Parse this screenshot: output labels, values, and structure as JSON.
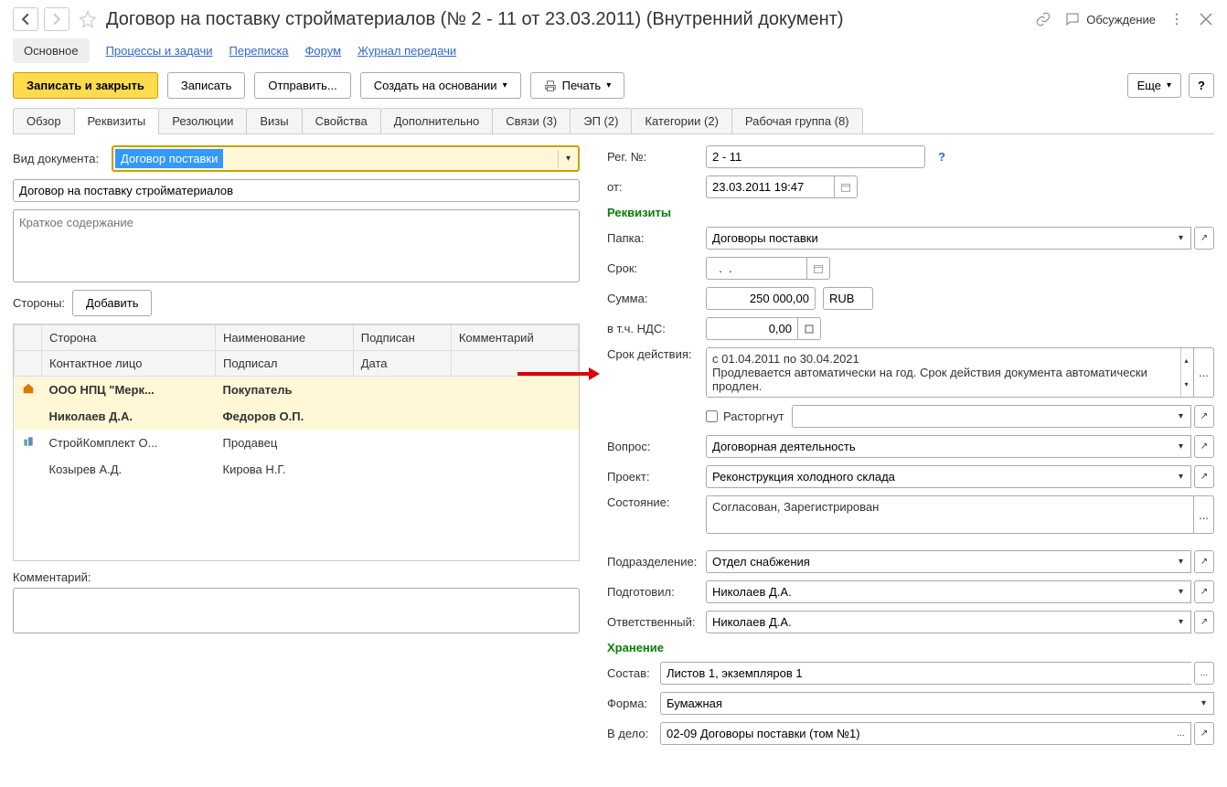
{
  "header": {
    "title": "Договор на поставку стройматериалов (№ 2 - 11 от 23.03.2011) (Внутренний документ)",
    "discuss": "Обсуждение"
  },
  "top_tabs": [
    "Основное",
    "Процессы и задачи",
    "Переписка",
    "Форум",
    "Журнал передачи"
  ],
  "toolbar": {
    "save_close": "Записать и закрыть",
    "save": "Записать",
    "send": "Отправить...",
    "create_based": "Создать на основании",
    "print": "Печать",
    "more": "Еще",
    "help": "?"
  },
  "subtabs": [
    "Обзор",
    "Реквизиты",
    "Резолюции",
    "Визы",
    "Свойства",
    "Дополнительно",
    "Связи (3)",
    "ЭП (2)",
    "Категории (2)",
    "Рабочая группа (8)"
  ],
  "left": {
    "doc_type_label": "Вид документа:",
    "doc_type_value": "Договор поставки",
    "name_value": "Договор на поставку стройматериалов",
    "summary_placeholder": "Краткое содержание",
    "parties_label": "Стороны:",
    "add_btn": "Добавить",
    "headers": {
      "side": "Сторона",
      "name": "Наименование",
      "signed": "Подписан",
      "comment": "Комментарий",
      "contact": "Контактное лицо",
      "signed_by": "Подписал",
      "date": "Дата"
    },
    "rows": [
      {
        "icon": "home",
        "side": "ООО НПЦ \"Мерк...",
        "name": "Покупатель",
        "signed": "",
        "comment": ""
      },
      {
        "side": "Николаев Д.А.",
        "name": "Федоров О.П.",
        "signed": "",
        "comment": ""
      },
      {
        "icon": "org",
        "side": "СтройКомплект О...",
        "name": "Продавец",
        "signed": "",
        "comment": ""
      },
      {
        "side": "Козырев А.Д.",
        "name": "Кирова Н.Г.",
        "signed": "",
        "comment": ""
      }
    ],
    "comment_label": "Комментарий:"
  },
  "right": {
    "reg_no_label": "Рег. №:",
    "reg_no_value": "2 - 11",
    "from_label": "от:",
    "from_value": "23.03.2011 19:47",
    "req_title": "Реквизиты",
    "folder_label": "Папка:",
    "folder_value": "Договоры поставки",
    "term_label": "Срок:",
    "term_value": "  .  .    ",
    "sum_label": "Сумма:",
    "sum_value": "250 000,00",
    "currency": "RUB",
    "vat_label": "в т.ч. НДС:",
    "vat_value": "0,00",
    "validity_label": "Срок действия:",
    "validity_line1": "с 01.04.2011 по 30.04.2021",
    "validity_line2": "Продлевается автоматически на год. Срок действия документа автоматически продлен.",
    "terminated_label": "Расторгнут",
    "question_label": "Вопрос:",
    "question_value": "Договорная деятельность",
    "project_label": "Проект:",
    "project_value": "Реконструкция холодного склада",
    "state_label": "Состояние:",
    "state_value": "Согласован, Зарегистрирован",
    "dept_label": "Подразделение:",
    "dept_value": "Отдел снабжения",
    "prepared_label": "Подготовил:",
    "prepared_value": "Николаев Д.А.",
    "responsible_label": "Ответственный:",
    "responsible_value": "Николаев Д.А.",
    "storage_title": "Хранение",
    "content_label": "Состав:",
    "content_value": "Листов 1, экземпляров 1",
    "form_label": "Форма:",
    "form_value": "Бумажная",
    "case_label": "В дело:",
    "case_value": "02-09 Договоры поставки (том №1)"
  }
}
